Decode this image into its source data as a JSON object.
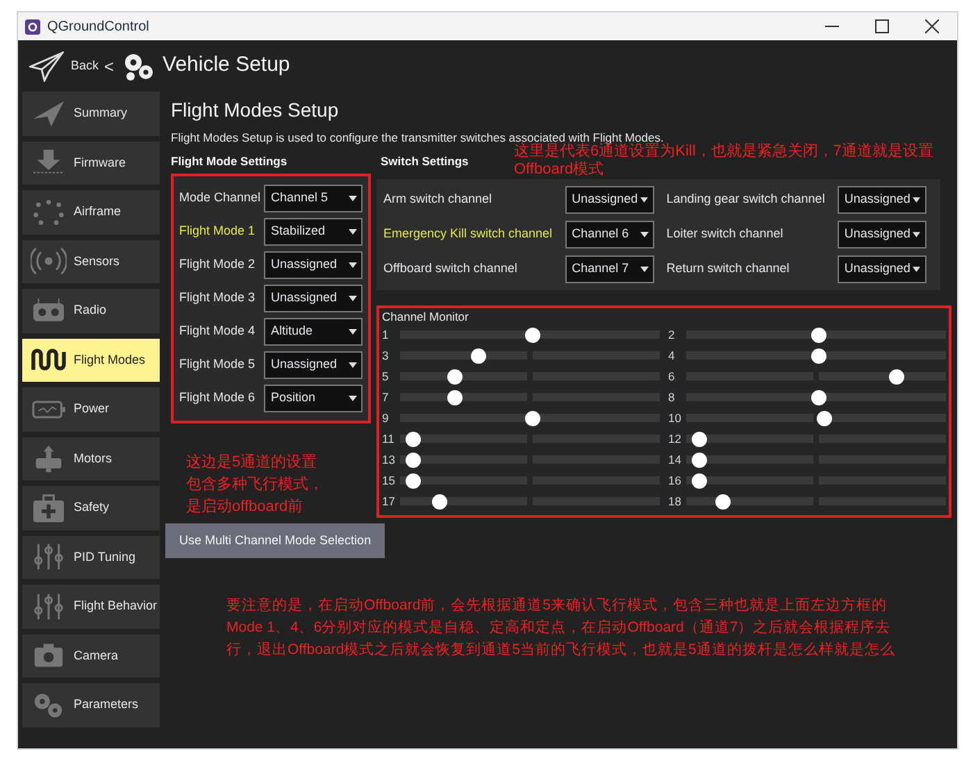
{
  "window": {
    "title": "QGroundControl"
  },
  "header": {
    "back": "Back",
    "separator": "<",
    "title": "Vehicle Setup"
  },
  "sidebar": {
    "items": [
      {
        "label": "Summary",
        "selected": false
      },
      {
        "label": "Firmware",
        "selected": false
      },
      {
        "label": "Airframe",
        "selected": false
      },
      {
        "label": "Sensors",
        "selected": false
      },
      {
        "label": "Radio",
        "selected": false
      },
      {
        "label": "Flight Modes",
        "selected": true
      },
      {
        "label": "Power",
        "selected": false
      },
      {
        "label": "Motors",
        "selected": false
      },
      {
        "label": "Safety",
        "selected": false
      },
      {
        "label": "PID Tuning",
        "selected": false
      },
      {
        "label": "Flight Behavior",
        "selected": false
      },
      {
        "label": "Camera",
        "selected": false
      },
      {
        "label": "Parameters",
        "selected": false
      }
    ]
  },
  "page": {
    "title": "Flight Modes Setup",
    "description": "Flight Modes Setup is used to configure the transmitter switches associated with Flight Modes."
  },
  "flight_mode_settings": {
    "heading": "Flight Mode Settings",
    "rows": [
      {
        "label": "Mode Channel",
        "value": "Channel 5",
        "highlighted": false
      },
      {
        "label": "Flight Mode 1",
        "value": "Stabilized",
        "highlighted": true
      },
      {
        "label": "Flight Mode 2",
        "value": "Unassigned",
        "highlighted": false
      },
      {
        "label": "Flight Mode 3",
        "value": "Unassigned",
        "highlighted": false
      },
      {
        "label": "Flight Mode 4",
        "value": "Altitude",
        "highlighted": false
      },
      {
        "label": "Flight Mode 5",
        "value": "Unassigned",
        "highlighted": false
      },
      {
        "label": "Flight Mode 6",
        "value": "Position",
        "highlighted": false
      }
    ]
  },
  "switch_settings": {
    "heading": "Switch Settings",
    "rows": [
      {
        "label": "Arm switch channel",
        "value": "Unassigned",
        "highlighted": false
      },
      {
        "label": "Landing gear switch channel",
        "value": "Unassigned",
        "highlighted": false
      },
      {
        "label": "Emergency Kill switch channel",
        "value": "Channel 6",
        "highlighted": true
      },
      {
        "label": "Loiter switch channel",
        "value": "Unassigned",
        "highlighted": false
      },
      {
        "label": "Offboard switch channel",
        "value": "Channel 7",
        "highlighted": false
      },
      {
        "label": "Return switch channel",
        "value": "Unassigned",
        "highlighted": false
      }
    ]
  },
  "channel_monitor": {
    "title": "Channel Monitor",
    "channels": [
      {
        "label": "1",
        "level": 0.51
      },
      {
        "label": "2",
        "level": 0.51
      },
      {
        "label": "3",
        "level": 0.3
      },
      {
        "label": "4",
        "level": 0.51
      },
      {
        "label": "5",
        "level": 0.21
      },
      {
        "label": "6",
        "level": 0.81
      },
      {
        "label": "7",
        "level": 0.21
      },
      {
        "label": "8",
        "level": 0.51
      },
      {
        "label": "9",
        "level": 0.51
      },
      {
        "label": "10",
        "level": 0.53
      },
      {
        "label": "11",
        "level": 0.05
      },
      {
        "label": "12",
        "level": 0.05
      },
      {
        "label": "13",
        "level": 0.05
      },
      {
        "label": "14",
        "level": 0.05
      },
      {
        "label": "15",
        "level": 0.05
      },
      {
        "label": "16",
        "level": 0.05
      },
      {
        "label": "17",
        "level": 0.15
      },
      {
        "label": "18",
        "level": 0.14
      }
    ]
  },
  "multi_channel_button": "Use Multi Channel Mode Selection",
  "annotations": [
    {
      "lines": [
        "这里是代表6通道设置为Kill，也就是紧急关闭，7通道就是设置",
        "Offboard模式"
      ]
    },
    {
      "lines": [
        "这边是5通道的设置",
        "包含多种飞行模式，",
        "是启动offboard前"
      ]
    },
    {
      "lines": [
        "要注意的是，在启动Offboard前，会先根据通道5来确认飞行模式，包含三种也就是上面左边方框的",
        "Mode 1、4、6分别对应的模式是自稳、定高和定点，在启动Offboard（通道7）之后就会根据程序去",
        "行，退出Offboard模式之后就会恢复到通道5当前的飞行模式，也就是5通道的拨杆是怎么样就是怎么"
      ]
    }
  ]
}
